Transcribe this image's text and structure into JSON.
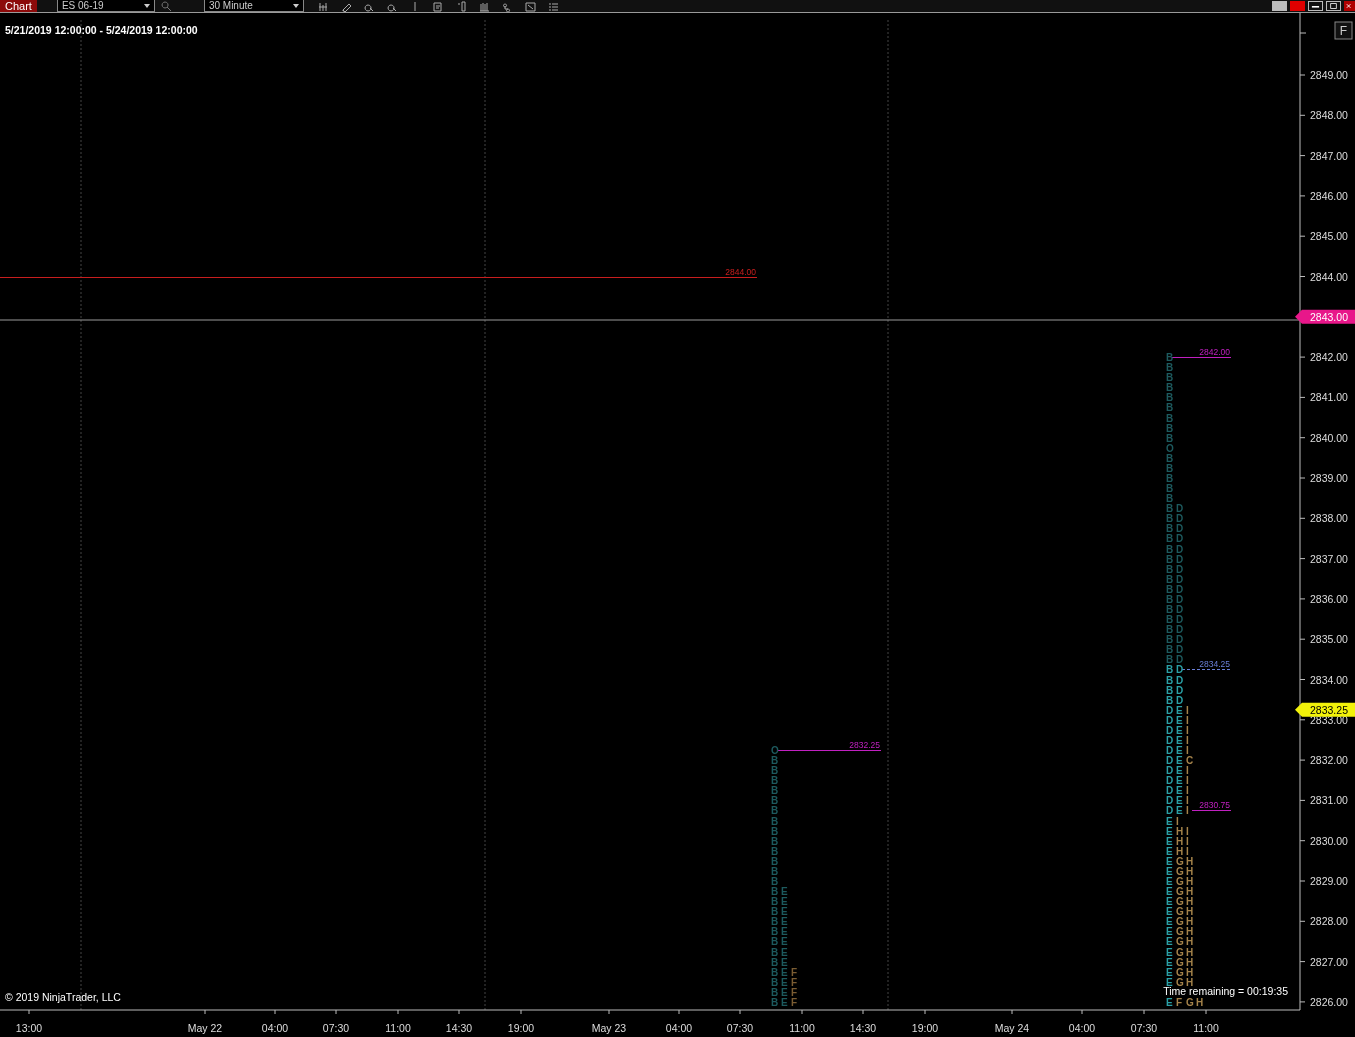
{
  "toolbar": {
    "title": "Chart",
    "instrument": "ES 06-19",
    "interval": "30 Minute"
  },
  "chart": {
    "range": "5/21/2019 12:00:00 - 5/24/2019 12:00:00",
    "corner_button": "F",
    "price_axis": [
      "2849.00",
      "2848.00",
      "2847.00",
      "2846.00",
      "2845.00",
      "2844.00",
      "2842.00",
      "2841.00",
      "2840.00",
      "2839.00",
      "2838.00",
      "2837.00",
      "2836.00",
      "2835.00",
      "2834.00",
      "2833.00",
      "2832.00",
      "2831.00",
      "2830.00",
      "2829.00",
      "2828.00",
      "2827.00",
      "2826.00"
    ],
    "time_axis": [
      "13:00",
      "May 22",
      "04:00",
      "07:30",
      "11:00",
      "14:30",
      "19:00",
      "May 23",
      "04:00",
      "07:30",
      "11:00",
      "14:30",
      "19:00",
      "May 24",
      "04:00",
      "07:30",
      "11:00"
    ],
    "price_markers": [
      {
        "label": "2843.00",
        "color": "#e8178a"
      },
      {
        "label": "2833.25",
        "color": "#f2f20a"
      }
    ],
    "levels": [
      {
        "label": "2844.00",
        "color": "#c81e1e",
        "kind": "solid"
      },
      {
        "label": "2832.25",
        "color": "#c020c0",
        "kind": "solid"
      },
      {
        "label": "2842.00",
        "color": "#c020c0",
        "kind": "solid"
      },
      {
        "label": "2834.25",
        "color": "#6a7fd8",
        "kind": "dashed"
      },
      {
        "label": "2830.75",
        "color": "#c020c0",
        "kind": "solid"
      }
    ],
    "profiles": [
      {
        "rows": [
          {
            "cells": [
              {
                "t": "O",
                "color": "#1d5a5e"
              }
            ]
          },
          {
            "cells": [
              {
                "t": "B",
                "color": "#1d5a5e"
              }
            ]
          },
          {
            "cells": [
              {
                "t": "B",
                "color": "#1d5a5e"
              }
            ]
          },
          {
            "cells": [
              {
                "t": "B",
                "color": "#1d5a5e"
              }
            ]
          },
          {
            "cells": [
              {
                "t": "B",
                "color": "#1d5a5e"
              }
            ]
          },
          {
            "cells": [
              {
                "t": "B",
                "color": "#1d5a5e"
              }
            ]
          },
          {
            "cells": [
              {
                "t": "B",
                "color": "#1d5a5e"
              }
            ]
          },
          {
            "cells": [
              {
                "t": "B",
                "color": "#1d5a5e"
              }
            ]
          },
          {
            "cells": [
              {
                "t": "B",
                "color": "#1d5a5e"
              }
            ]
          },
          {
            "cells": [
              {
                "t": "B",
                "color": "#1d5a5e"
              }
            ]
          },
          {
            "cells": [
              {
                "t": "B",
                "color": "#1d5a5e"
              }
            ]
          },
          {
            "cells": [
              {
                "t": "B",
                "color": "#1d5a5e"
              }
            ]
          },
          {
            "cells": [
              {
                "t": "B",
                "color": "#1d5a5e"
              }
            ]
          },
          {
            "cells": [
              {
                "t": "B",
                "color": "#1d5a5e"
              }
            ]
          },
          {
            "cells": [
              {
                "t": "B",
                "color": "#1d5a5e"
              },
              {
                "t": "E",
                "color": "#1d5a5e"
              }
            ]
          },
          {
            "cells": [
              {
                "t": "B",
                "color": "#1d5a5e"
              },
              {
                "t": "E",
                "color": "#1d5a5e"
              }
            ]
          },
          {
            "cells": [
              {
                "t": "B",
                "color": "#1d5a5e"
              },
              {
                "t": "E",
                "color": "#1d5a5e"
              }
            ]
          },
          {
            "cells": [
              {
                "t": "B",
                "color": "#1d5a5e"
              },
              {
                "t": "E",
                "color": "#1d5a5e"
              }
            ]
          },
          {
            "cells": [
              {
                "t": "B",
                "color": "#1d5a5e"
              },
              {
                "t": "E",
                "color": "#1d5a5e"
              }
            ]
          },
          {
            "cells": [
              {
                "t": "B",
                "color": "#1d5a5e"
              },
              {
                "t": "E",
                "color": "#1d5a5e"
              }
            ]
          },
          {
            "cells": [
              {
                "t": "B",
                "color": "#1d5a5e"
              },
              {
                "t": "E",
                "color": "#1d5a5e"
              }
            ]
          },
          {
            "cells": [
              {
                "t": "B",
                "color": "#1d5a5e"
              },
              {
                "t": "E",
                "color": "#1d5a5e"
              }
            ]
          },
          {
            "cells": [
              {
                "t": "B",
                "color": "#1d5a5e"
              },
              {
                "t": "E",
                "color": "#1d5a5e"
              },
              {
                "t": "F",
                "color": "#7a5c32"
              }
            ]
          },
          {
            "cells": [
              {
                "t": "B",
                "color": "#1d5a5e"
              },
              {
                "t": "E",
                "color": "#1d5a5e"
              },
              {
                "t": "F",
                "color": "#7a5c32"
              }
            ]
          },
          {
            "cells": [
              {
                "t": "B",
                "color": "#1d5a5e"
              },
              {
                "t": "E",
                "color": "#1d5a5e"
              },
              {
                "t": "F",
                "color": "#7a5c32"
              }
            ]
          },
          {
            "cells": [
              {
                "t": "B",
                "color": "#1d5a5e"
              },
              {
                "t": "E",
                "color": "#1d5a5e"
              },
              {
                "t": "F",
                "color": "#7a5c32"
              }
            ]
          }
        ]
      },
      {
        "rows": [
          {
            "cells": [
              {
                "t": "B",
                "color": "#1d5a5e"
              }
            ]
          },
          {
            "cells": [
              {
                "t": "B",
                "color": "#1d5a5e"
              }
            ]
          },
          {
            "cells": [
              {
                "t": "B",
                "color": "#1d5a5e"
              }
            ]
          },
          {
            "cells": [
              {
                "t": "B",
                "color": "#1d5a5e"
              }
            ]
          },
          {
            "cells": [
              {
                "t": "B",
                "color": "#1d5a5e"
              }
            ]
          },
          {
            "cells": [
              {
                "t": "B",
                "color": "#1d5a5e"
              }
            ]
          },
          {
            "cells": [
              {
                "t": "B",
                "color": "#1d5a5e"
              }
            ]
          },
          {
            "cells": [
              {
                "t": "B",
                "color": "#1d5a5e"
              }
            ]
          },
          {
            "cells": [
              {
                "t": "B",
                "color": "#1d5a5e"
              }
            ]
          },
          {
            "cells": [
              {
                "t": "O",
                "color": "#1d5a5e"
              }
            ]
          },
          {
            "cells": [
              {
                "t": "B",
                "color": "#1d5a5e"
              }
            ]
          },
          {
            "cells": [
              {
                "t": "B",
                "color": "#1d5a5e"
              }
            ]
          },
          {
            "cells": [
              {
                "t": "B",
                "color": "#1d5a5e"
              }
            ]
          },
          {
            "cells": [
              {
                "t": "B",
                "color": "#1d5a5e"
              }
            ]
          },
          {
            "cells": [
              {
                "t": "B",
                "color": "#1d5a5e"
              }
            ]
          },
          {
            "cells": [
              {
                "t": "B",
                "color": "#1d5a5e"
              },
              {
                "t": "D",
                "color": "#1d5a5e"
              }
            ]
          },
          {
            "cells": [
              {
                "t": "B",
                "color": "#1d5a5e"
              },
              {
                "t": "D",
                "color": "#1d5a5e"
              }
            ]
          },
          {
            "cells": [
              {
                "t": "B",
                "color": "#1d5a5e"
              },
              {
                "t": "D",
                "color": "#1d5a5e"
              }
            ]
          },
          {
            "cells": [
              {
                "t": "B",
                "color": "#1d5a5e"
              },
              {
                "t": "D",
                "color": "#1d5a5e"
              }
            ]
          },
          {
            "cells": [
              {
                "t": "B",
                "color": "#1d5a5e"
              },
              {
                "t": "D",
                "color": "#1d5a5e"
              }
            ]
          },
          {
            "cells": [
              {
                "t": "B",
                "color": "#1d5a5e"
              },
              {
                "t": "D",
                "color": "#1d5a5e"
              }
            ]
          },
          {
            "cells": [
              {
                "t": "B",
                "color": "#1d5a5e"
              },
              {
                "t": "D",
                "color": "#1d5a5e"
              }
            ]
          },
          {
            "cells": [
              {
                "t": "B",
                "color": "#1d5a5e"
              },
              {
                "t": "D",
                "color": "#1d5a5e"
              }
            ]
          },
          {
            "cells": [
              {
                "t": "B",
                "color": "#1d5a5e"
              },
              {
                "t": "D",
                "color": "#1d5a5e"
              }
            ]
          },
          {
            "cells": [
              {
                "t": "B",
                "color": "#1d5a5e"
              },
              {
                "t": "D",
                "color": "#1d5a5e"
              }
            ]
          },
          {
            "cells": [
              {
                "t": "B",
                "color": "#1d5a5e"
              },
              {
                "t": "D",
                "color": "#1d5a5e"
              }
            ]
          },
          {
            "cells": [
              {
                "t": "B",
                "color": "#1d5a5e"
              },
              {
                "t": "D",
                "color": "#1d5a5e"
              }
            ]
          },
          {
            "cells": [
              {
                "t": "B",
                "color": "#1d5a5e"
              },
              {
                "t": "D",
                "color": "#1d5a5e"
              }
            ]
          },
          {
            "cells": [
              {
                "t": "B",
                "color": "#1d5a5e"
              },
              {
                "t": "D",
                "color": "#1d5a5e"
              }
            ]
          },
          {
            "cells": [
              {
                "t": "B",
                "color": "#1d5a5e"
              },
              {
                "t": "D",
                "color": "#1d5a5e"
              }
            ]
          },
          {
            "cells": [
              {
                "t": "B",
                "color": "#1d5a5e"
              },
              {
                "t": "D",
                "color": "#1d5a5e"
              }
            ]
          },
          {
            "cells": [
              {
                "t": "B",
                "color": "#2aa0a6"
              },
              {
                "t": "D",
                "color": "#2aa0a6"
              }
            ]
          },
          {
            "cells": [
              {
                "t": "B",
                "color": "#2aa0a6"
              },
              {
                "t": "D",
                "color": "#2aa0a6"
              }
            ]
          },
          {
            "cells": [
              {
                "t": "B",
                "color": "#2aa0a6"
              },
              {
                "t": "D",
                "color": "#2aa0a6"
              }
            ]
          },
          {
            "cells": [
              {
                "t": "B",
                "color": "#2aa0a6"
              },
              {
                "t": "D",
                "color": "#2aa0a6"
              }
            ]
          },
          {
            "cells": [
              {
                "t": "D",
                "color": "#2aa0a6"
              },
              {
                "t": "E",
                "color": "#2aa0a6"
              },
              {
                "t": "I",
                "color": "#a5834a"
              }
            ]
          },
          {
            "cells": [
              {
                "t": "D",
                "color": "#2aa0a6"
              },
              {
                "t": "E",
                "color": "#2aa0a6"
              },
              {
                "t": "I",
                "color": "#a5834a"
              }
            ]
          },
          {
            "cells": [
              {
                "t": "D",
                "color": "#2aa0a6"
              },
              {
                "t": "E",
                "color": "#2aa0a6"
              },
              {
                "t": "I",
                "color": "#a5834a"
              }
            ]
          },
          {
            "cells": [
              {
                "t": "D",
                "color": "#2aa0a6"
              },
              {
                "t": "E",
                "color": "#2aa0a6"
              },
              {
                "t": "I",
                "color": "#a5834a"
              }
            ]
          },
          {
            "cells": [
              {
                "t": "D",
                "color": "#2aa0a6"
              },
              {
                "t": "E",
                "color": "#2aa0a6"
              },
              {
                "t": "I",
                "color": "#a5834a"
              }
            ]
          },
          {
            "cells": [
              {
                "t": "D",
                "color": "#2aa0a6"
              },
              {
                "t": "E",
                "color": "#2aa0a6"
              },
              {
                "t": "C",
                "color": "#a5834a"
              }
            ]
          },
          {
            "cells": [
              {
                "t": "D",
                "color": "#2aa0a6"
              },
              {
                "t": "E",
                "color": "#2aa0a6"
              },
              {
                "t": "I",
                "color": "#a5834a"
              }
            ]
          },
          {
            "cells": [
              {
                "t": "D",
                "color": "#2aa0a6"
              },
              {
                "t": "E",
                "color": "#2aa0a6"
              },
              {
                "t": "I",
                "color": "#a5834a"
              }
            ]
          },
          {
            "cells": [
              {
                "t": "D",
                "color": "#2aa0a6"
              },
              {
                "t": "E",
                "color": "#2aa0a6"
              },
              {
                "t": "I",
                "color": "#a5834a"
              }
            ]
          },
          {
            "cells": [
              {
                "t": "D",
                "color": "#2aa0a6"
              },
              {
                "t": "E",
                "color": "#2aa0a6"
              },
              {
                "t": "I",
                "color": "#a5834a"
              }
            ]
          },
          {
            "cells": [
              {
                "t": "D",
                "color": "#2aa0a6"
              },
              {
                "t": "E",
                "color": "#2aa0a6"
              },
              {
                "t": "I",
                "color": "#a5834a"
              }
            ]
          },
          {
            "cells": [
              {
                "t": "E",
                "color": "#2aa0a6"
              },
              {
                "t": "I",
                "color": "#a5834a"
              }
            ]
          },
          {
            "cells": [
              {
                "t": "E",
                "color": "#2aa0a6"
              },
              {
                "t": "H",
                "color": "#a5834a"
              },
              {
                "t": "I",
                "color": "#a5834a"
              }
            ]
          },
          {
            "cells": [
              {
                "t": "E",
                "color": "#2aa0a6"
              },
              {
                "t": "H",
                "color": "#a5834a"
              },
              {
                "t": "I",
                "color": "#a5834a"
              }
            ]
          },
          {
            "cells": [
              {
                "t": "E",
                "color": "#2aa0a6"
              },
              {
                "t": "H",
                "color": "#a5834a"
              },
              {
                "t": "I",
                "color": "#a5834a"
              }
            ]
          },
          {
            "cells": [
              {
                "t": "E",
                "color": "#2aa0a6"
              },
              {
                "t": "G",
                "color": "#a5834a"
              },
              {
                "t": "H",
                "color": "#a5834a"
              }
            ]
          },
          {
            "cells": [
              {
                "t": "E",
                "color": "#2aa0a6"
              },
              {
                "t": "G",
                "color": "#a5834a"
              },
              {
                "t": "H",
                "color": "#a5834a"
              }
            ]
          },
          {
            "cells": [
              {
                "t": "E",
                "color": "#2aa0a6"
              },
              {
                "t": "G",
                "color": "#a5834a"
              },
              {
                "t": "H",
                "color": "#a5834a"
              }
            ]
          },
          {
            "cells": [
              {
                "t": "E",
                "color": "#2aa0a6"
              },
              {
                "t": "G",
                "color": "#a5834a"
              },
              {
                "t": "H",
                "color": "#a5834a"
              }
            ]
          },
          {
            "cells": [
              {
                "t": "E",
                "color": "#2aa0a6"
              },
              {
                "t": "G",
                "color": "#a5834a"
              },
              {
                "t": "H",
                "color": "#a5834a"
              }
            ]
          },
          {
            "cells": [
              {
                "t": "E",
                "color": "#2aa0a6"
              },
              {
                "t": "G",
                "color": "#a5834a"
              },
              {
                "t": "H",
                "color": "#a5834a"
              }
            ]
          },
          {
            "cells": [
              {
                "t": "E",
                "color": "#2aa0a6"
              },
              {
                "t": "G",
                "color": "#a5834a"
              },
              {
                "t": "H",
                "color": "#a5834a"
              }
            ]
          },
          {
            "cells": [
              {
                "t": "E",
                "color": "#2aa0a6"
              },
              {
                "t": "G",
                "color": "#a5834a"
              },
              {
                "t": "H",
                "color": "#a5834a"
              }
            ]
          },
          {
            "cells": [
              {
                "t": "E",
                "color": "#2aa0a6"
              },
              {
                "t": "G",
                "color": "#a5834a"
              },
              {
                "t": "H",
                "color": "#a5834a"
              }
            ]
          },
          {
            "cells": [
              {
                "t": "E",
                "color": "#2aa0a6"
              },
              {
                "t": "G",
                "color": "#a5834a"
              },
              {
                "t": "H",
                "color": "#a5834a"
              }
            ]
          },
          {
            "cells": [
              {
                "t": "E",
                "color": "#2aa0a6"
              },
              {
                "t": "G",
                "color": "#a5834a"
              },
              {
                "t": "H",
                "color": "#a5834a"
              }
            ]
          },
          {
            "cells": [
              {
                "t": "E",
                "color": "#2aa0a6"
              },
              {
                "t": "G",
                "color": "#a5834a"
              },
              {
                "t": "H",
                "color": "#a5834a"
              }
            ]
          },
          {
            "cells": [
              {
                "t": "E",
                "color": "#2aa0a6"
              },
              {
                "t": "G",
                "color": "#a5834a"
              },
              {
                "t": "H",
                "color": "#a5834a"
              }
            ]
          }
        ]
      },
      {
        "rows": [
          {
            "cells": [
              {
                "t": "E",
                "color": "#2aa0a6"
              },
              {
                "t": "F",
                "color": "#a5834a"
              },
              {
                "t": "G",
                "color": "#a5834a"
              },
              {
                "t": "H",
                "color": "#a5834a"
              }
            ]
          }
        ]
      }
    ],
    "copyright": "© 2019 NinjaTrader, LLC",
    "timer": "Time remaining = 00:19:35"
  }
}
